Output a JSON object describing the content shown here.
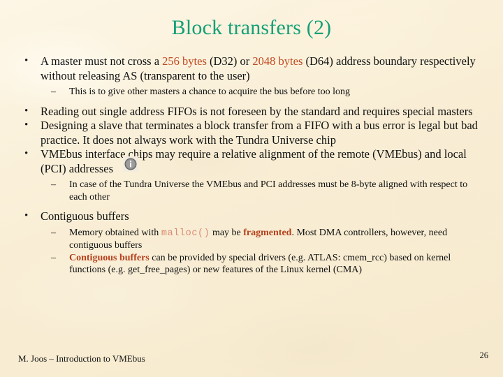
{
  "slide": {
    "title": "Block transfers (2)",
    "title_color": "#14a077",
    "background_color": "#fbf0d9",
    "highlight_color": "#c0481f",
    "mono_color": "#d98a72",
    "bullet_marker": "•",
    "dash_marker": "–"
  },
  "content": {
    "b1": {
      "t1": "A master must not cross a ",
      "h1": "256 bytes",
      "t2": " (D32) or ",
      "h2": "2048 bytes",
      "t3": " (D64) address boundary respectively without releasing AS (transparent to the user)"
    },
    "b1s1": "This is to give other masters a chance to acquire the bus before too long",
    "b2": "Reading out single address FIFOs is not foreseen by the standard and requires special masters",
    "b3": "Designing a slave that terminates a block transfer from a FIFO with a bus error is legal but bad practice. It does not always work with the Tundra Universe chip",
    "b4": "VMEbus interface chips may require a relative alignment of the remote (VMEbus) and local (PCI) addresses",
    "b4s1": "In case of the Tundra Universe the VMEbus and PCI addresses must be 8-byte aligned with respect to each other",
    "b5": "Contiguous buffers",
    "b5s1": {
      "t1": "Memory obtained with ",
      "code": "malloc()",
      "t2": " may be ",
      "h1": "fragmented",
      "t3": ". Most DMA controllers, however, need contiguous buffers"
    },
    "b5s2": {
      "h1": "Contiguous buffers",
      "t1": " can be provided by special drivers (e.g. ATLAS: cmem_rcc) based on kernel functions (e.g. get_free_pages) or new features of the Linux kernel (CMA)"
    }
  },
  "icons": {
    "info": "info-icon"
  },
  "footer": {
    "author_line": "M. Joos – Introduction to VMEbus",
    "page_number": "26"
  }
}
